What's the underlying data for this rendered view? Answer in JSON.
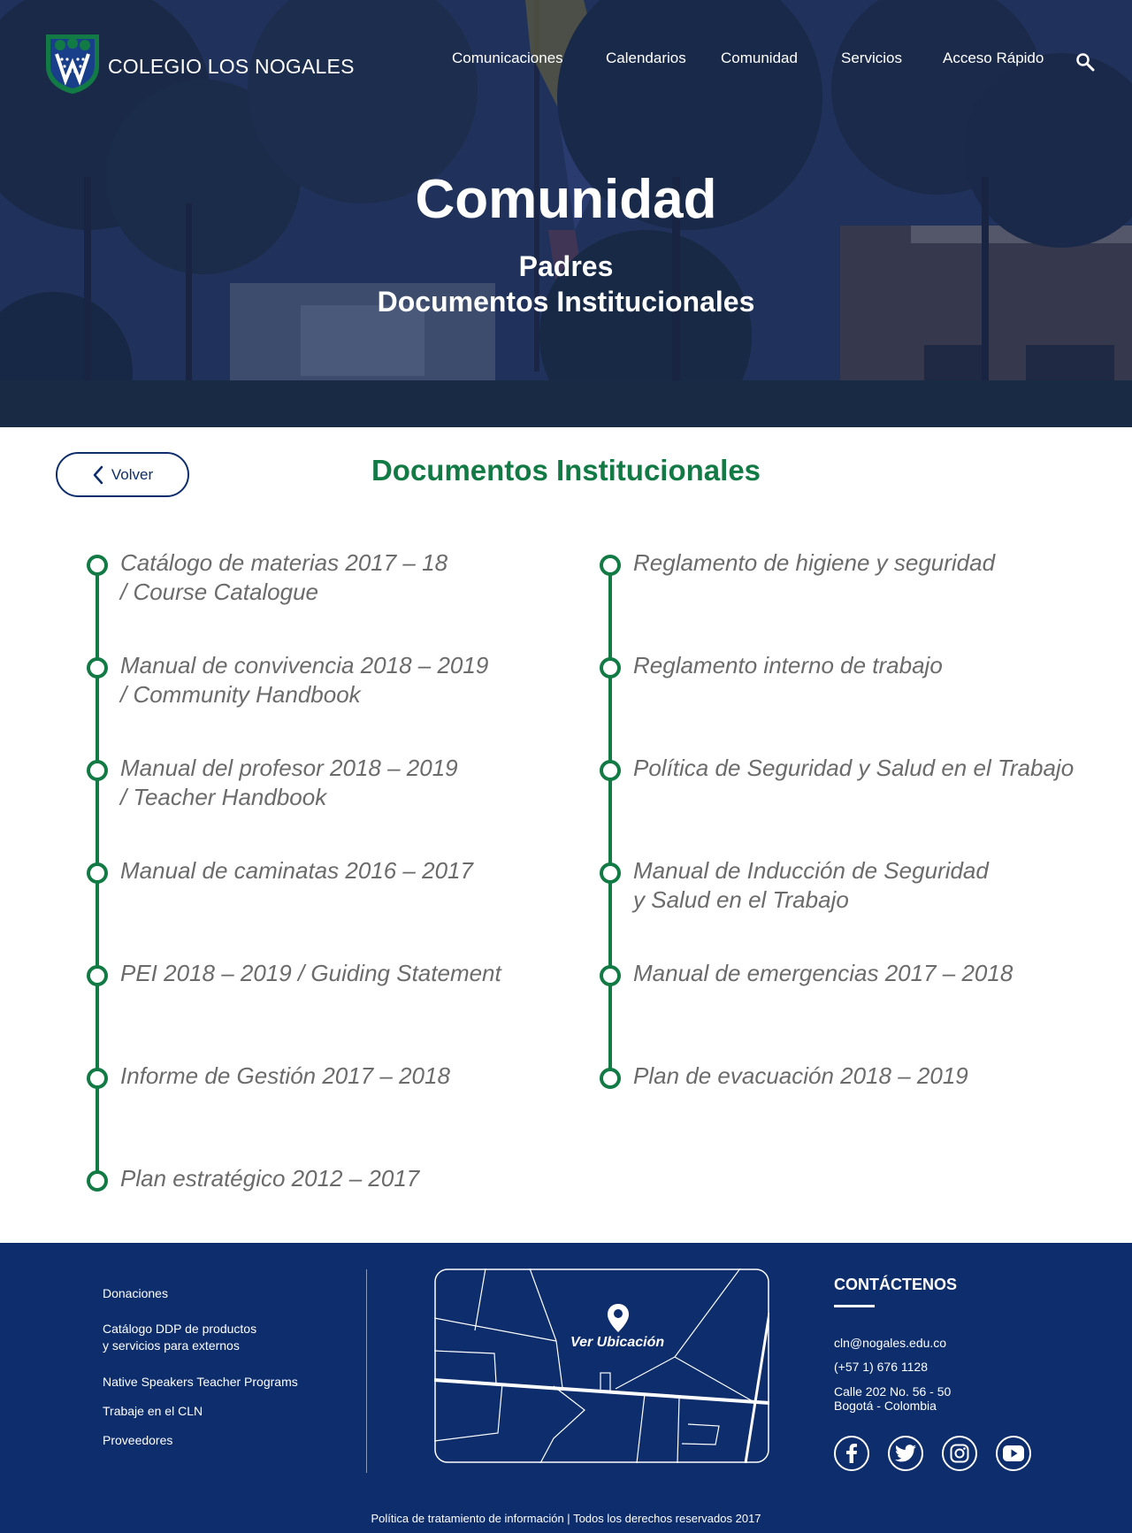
{
  "header": {
    "logo_text": "COLEGIO LOS NOGALES",
    "nav": [
      "Comunicaciones",
      "Calendarios",
      "Comunidad",
      "Servicios",
      "Acceso Rápido"
    ]
  },
  "hero": {
    "title": "Comunidad",
    "subtitle_line1": "Padres",
    "subtitle_line2": "Documentos Institucionales"
  },
  "main": {
    "back_label": "Volver",
    "section_title": "Documentos Institucionales",
    "left_docs": [
      {
        "line1": "Catálogo de materias 2017 – 18",
        "line2": "/ Course Catalogue"
      },
      {
        "line1": "Manual de convivencia 2018 – 2019",
        "line2": "/ Community Handbook"
      },
      {
        "line1": "Manual del profesor 2018 – 2019",
        "line2": "/ Teacher Handbook"
      },
      {
        "line1": "Manual de caminatas 2016 – 2017",
        "line2": ""
      },
      {
        "line1": "PEI 2018 – 2019 / Guiding Statement",
        "line2": ""
      },
      {
        "line1": "Informe de Gestión 2017 – 2018",
        "line2": ""
      },
      {
        "line1": "Plan estratégico 2012 – 2017",
        "line2": ""
      }
    ],
    "right_docs": [
      {
        "line1": "Reglamento de higiene y seguridad",
        "line2": ""
      },
      {
        "line1": "Reglamento interno de trabajo",
        "line2": ""
      },
      {
        "line1": "Política de Seguridad y Salud en el Trabajo",
        "line2": ""
      },
      {
        "line1": "Manual de Inducción de Seguridad",
        "line2": "y Salud en el Trabajo"
      },
      {
        "line1": "Manual de emergencias 2017 – 2018",
        "line2": ""
      },
      {
        "line1": "Plan de evacuación 2018 – 2019",
        "line2": ""
      }
    ]
  },
  "footer": {
    "links": {
      "donaciones": "Donaciones",
      "catalogo_1": "Catálogo DDP de productos",
      "catalogo_2": "y servicios para externos",
      "native": "Native Speakers Teacher Programs",
      "trabaje": "Trabaje en el CLN",
      "proveedores": "Proveedores"
    },
    "map_label": "Ver Ubicación",
    "contact_title": "CONTÁCTENOS",
    "email": "cln@nogales.edu.co",
    "phone": "(+57 1) 676 1128",
    "address_1": "Calle 202 No. 56 - 50",
    "address_2": "Bogotá - Colombia",
    "social_icons": [
      "facebook-icon",
      "twitter-icon",
      "instagram-icon",
      "youtube-icon"
    ],
    "policy_link": "Política de tratamiento de información",
    "separator": " | ",
    "rights": "Todos los derechos reservados 2017"
  },
  "colors": {
    "brand_navy": "#0d2d6c",
    "brand_green": "#127a45",
    "doc_text": "#6b6b6b"
  }
}
